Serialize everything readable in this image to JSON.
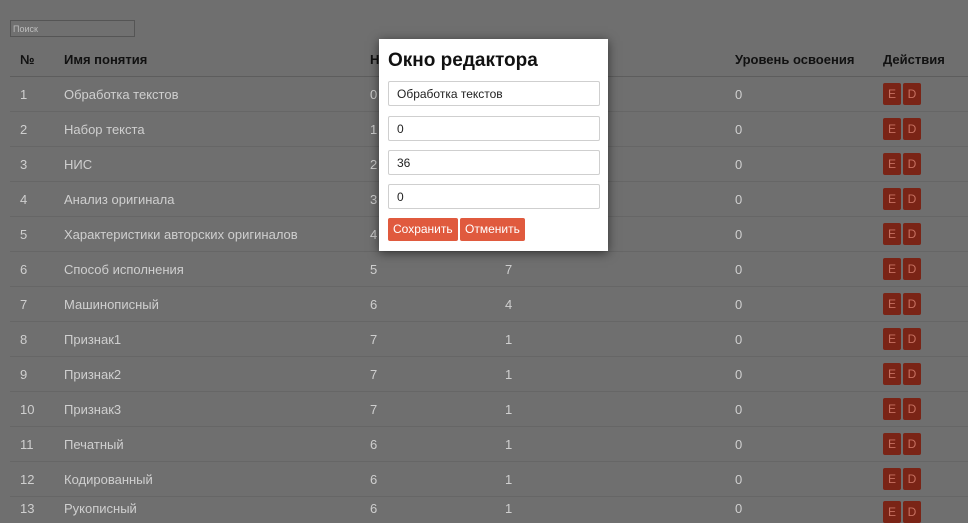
{
  "search": {
    "placeholder": "Поиск"
  },
  "table": {
    "headers": [
      "№",
      "Имя понятия",
      "Н",
      "",
      "Уровень освоения",
      "Действия"
    ],
    "action_labels": {
      "edit": "E",
      "delete": "D"
    },
    "rows": [
      {
        "num": "1",
        "name": "Обработка текстов",
        "a": "0",
        "b": "",
        "level": "0"
      },
      {
        "num": "2",
        "name": "Набор текста",
        "a": "1",
        "b": "",
        "level": "0"
      },
      {
        "num": "3",
        "name": "НИС",
        "a": "2",
        "b": "",
        "level": "0"
      },
      {
        "num": "4",
        "name": "Анализ оригинала",
        "a": "3",
        "b": "",
        "level": "0"
      },
      {
        "num": "5",
        "name": "Характеристики авторских оригиналов",
        "a": "4",
        "b": "",
        "level": "0"
      },
      {
        "num": "6",
        "name": "Способ исполнения",
        "a": "5",
        "b": "7",
        "level": "0"
      },
      {
        "num": "7",
        "name": "Машинописный",
        "a": "6",
        "b": "4",
        "level": "0"
      },
      {
        "num": "8",
        "name": "Признак1",
        "a": "7",
        "b": "1",
        "level": "0"
      },
      {
        "num": "9",
        "name": "Признак2",
        "a": "7",
        "b": "1",
        "level": "0"
      },
      {
        "num": "10",
        "name": "Признак3",
        "a": "7",
        "b": "1",
        "level": "0"
      },
      {
        "num": "11",
        "name": "Печатный",
        "a": "6",
        "b": "1",
        "level": "0"
      },
      {
        "num": "12",
        "name": "Кодированный",
        "a": "6",
        "b": "1",
        "level": "0"
      },
      {
        "num": "13",
        "name": "Рукописный",
        "a": "6",
        "b": "1",
        "level": "0"
      }
    ]
  },
  "modal": {
    "title": "Окно редактора",
    "fields": [
      "Обработка текстов",
      "0",
      "36",
      "0"
    ],
    "save_label": "Сохранить",
    "cancel_label": "Отменить"
  },
  "colors": {
    "overlay": "#6f6f6f",
    "action_button": "#7a2416",
    "primary_button": "#e05a3e"
  }
}
